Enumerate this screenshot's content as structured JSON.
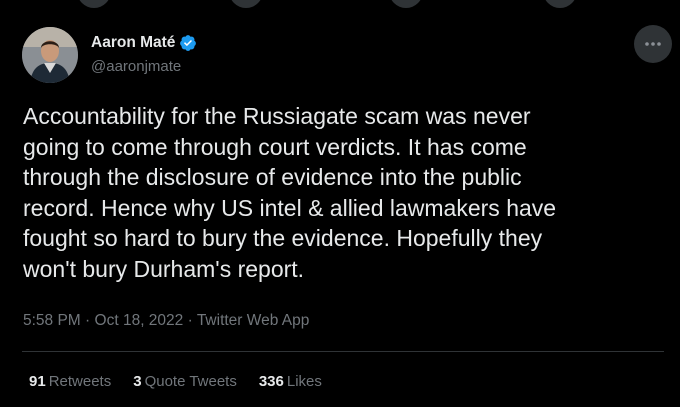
{
  "author": {
    "display_name": "Aaron Maté",
    "handle": "@aaronjmate",
    "verified": true,
    "accent_color": "#1d9bf0"
  },
  "tweet": {
    "text": "Accountability for the Russiagate scam was never\ngoing to come through court verdicts. It has come\nthrough the disclosure of evidence into the public\nrecord. Hence why US intel & allied lawmakers have\nfought so hard to bury the evidence. Hopefully they\nwon't bury Durham's report.",
    "time": "5:58 PM",
    "separator": "·",
    "date": "Oct 18, 2022",
    "source": "Twitter Web App"
  },
  "stats": {
    "retweets_count": "91",
    "retweets_label": "Retweets",
    "quotes_count": "3",
    "quotes_label": "Quote Tweets",
    "likes_count": "336",
    "likes_label": "Likes"
  },
  "icons": {
    "more": "more-horizontal-icon",
    "verified": "verified-badge-icon"
  }
}
